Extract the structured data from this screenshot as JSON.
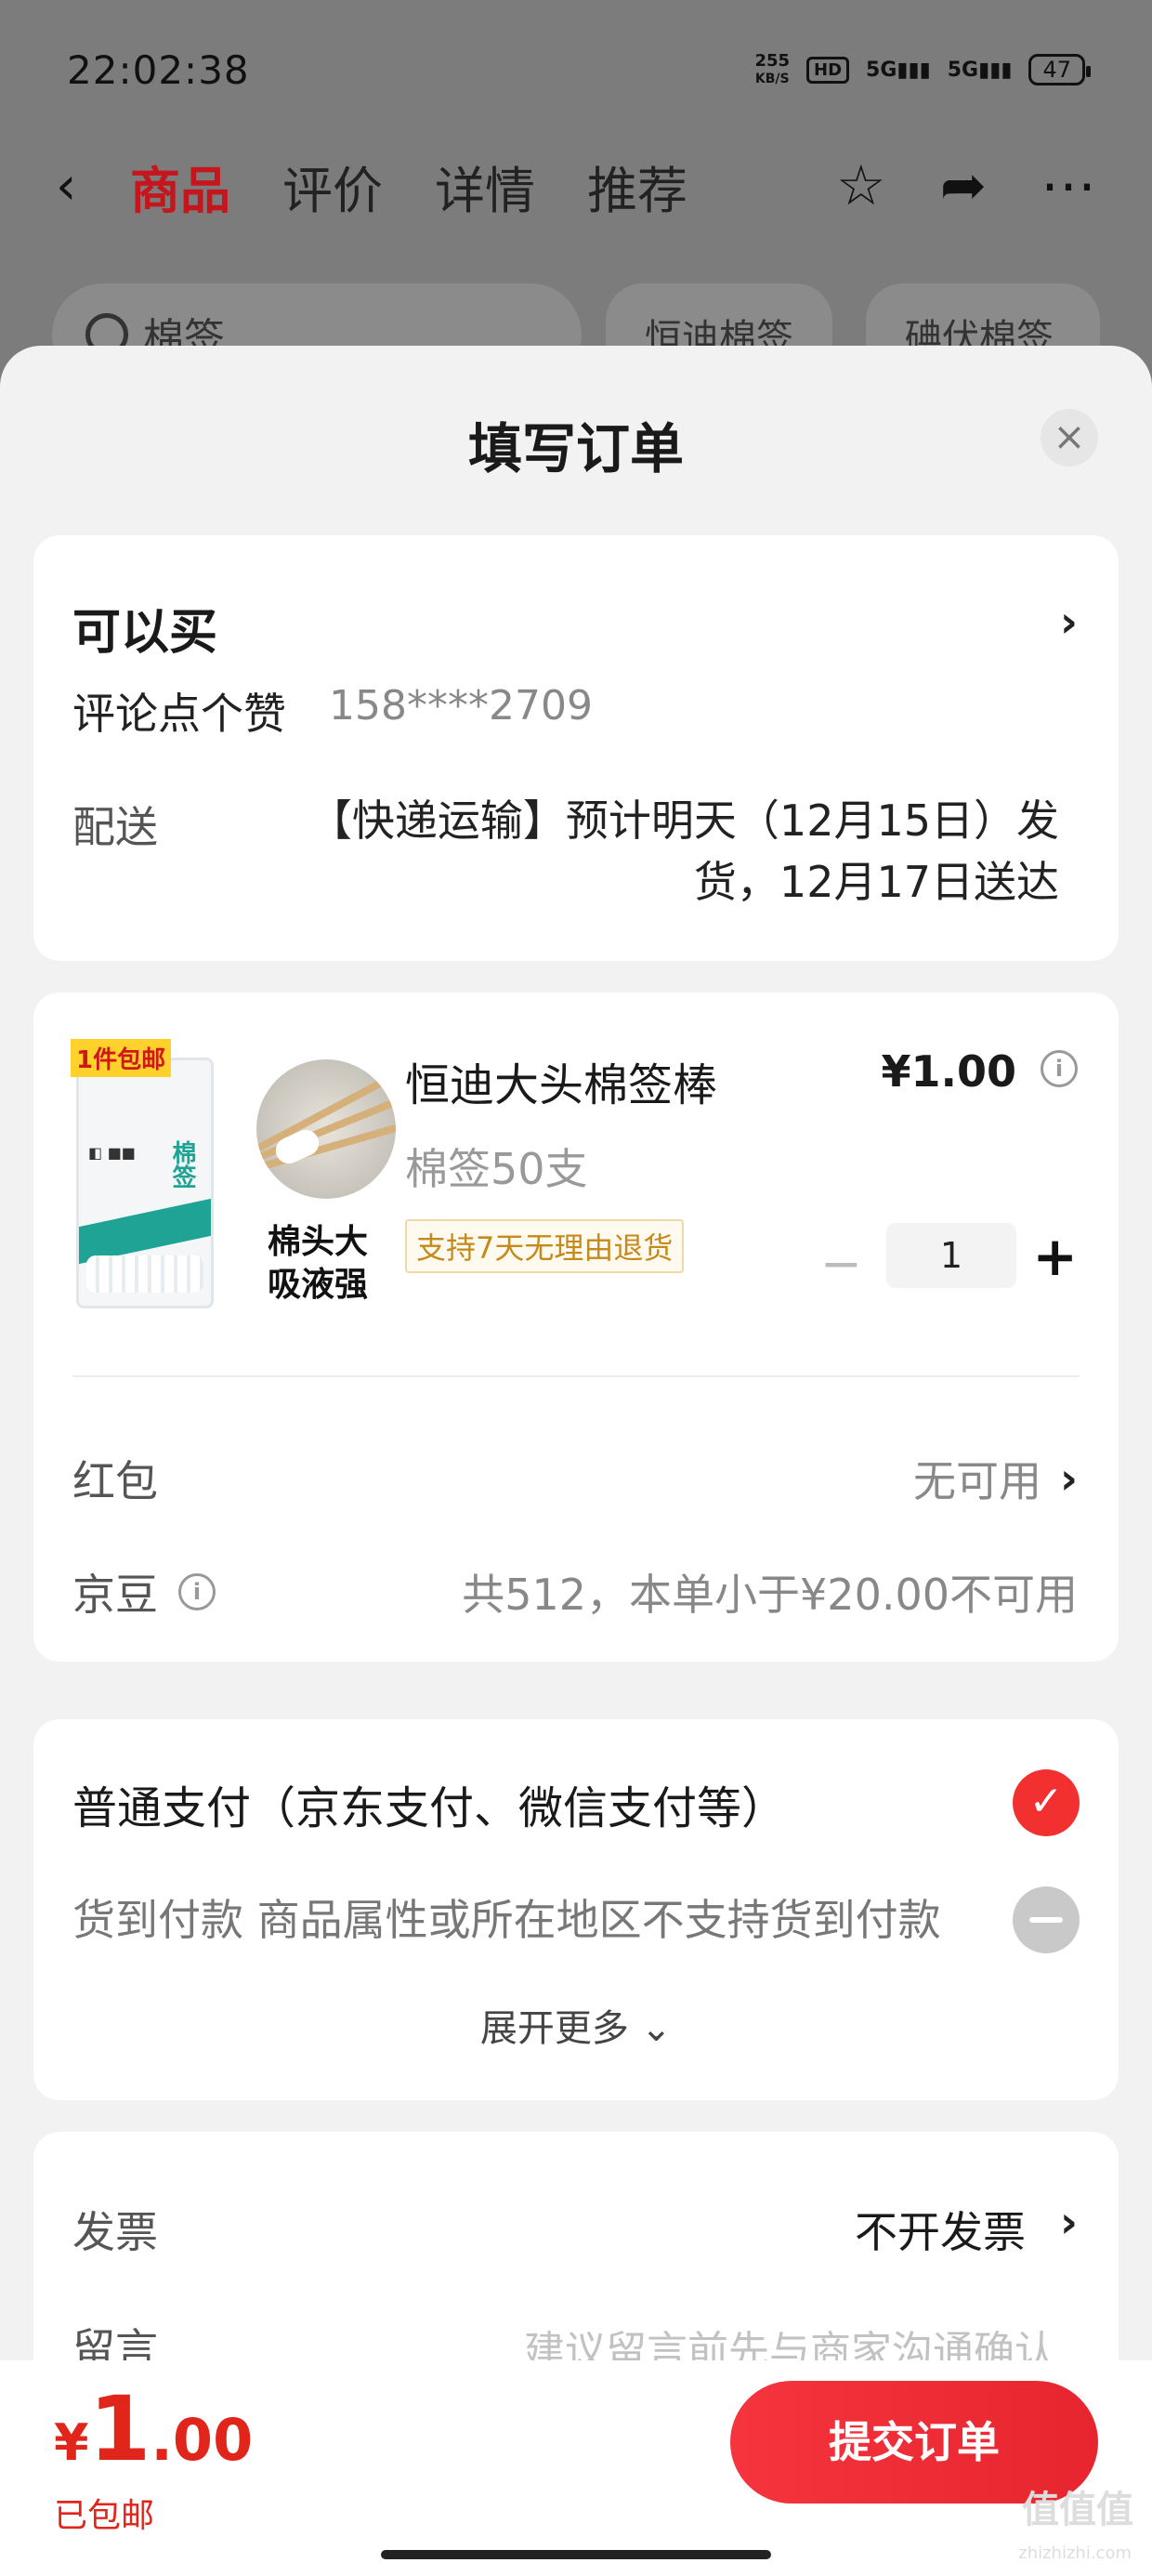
{
  "status_bar": {
    "time": "22:02:38",
    "speed": "255",
    "speed_unit": "KB/S",
    "hd": "HD",
    "signal1": "5G",
    "signal2": "5G",
    "battery": "47"
  },
  "nav": {
    "tabs": [
      "商品",
      "评价",
      "详情",
      "推荐"
    ],
    "active_tab": "商品"
  },
  "background": {
    "search_text": "棉签",
    "chips": [
      "恒迪棉签",
      "碘伏棉签"
    ]
  },
  "sheet": {
    "title": "填写订单",
    "close": "×"
  },
  "address": {
    "name": "可以买",
    "user": "评论点个赞",
    "phone": "158****2709",
    "delivery_label": "配送",
    "delivery_text": "【快递运输】预计明天（12月15日）发货，12月17日送达"
  },
  "product": {
    "badge": "1件包邮",
    "image_text_line1": "棉头大",
    "image_text_line2": "吸液强",
    "package_brand": "棉签",
    "title": "恒迪大头棉签棒",
    "spec": "棉签50支",
    "return_policy": "支持7天无理由退货",
    "price": "¥1.00",
    "quantity": "1",
    "minus": "−",
    "plus": "+"
  },
  "discounts": {
    "redpacket_label": "红包",
    "redpacket_value": "无可用",
    "jingdou_label": "京豆",
    "jingdou_value": "共512，本单小于¥20.00不可用"
  },
  "payment": {
    "option1": "普通支付（京东支付、微信支付等）",
    "option2": "货到付款 商品属性或所在地区不支持货到付款",
    "more": "展开更多 ⌄"
  },
  "invoice": {
    "label": "发票",
    "value": "不开发票",
    "note_label": "留言",
    "note_placeholder": "建议留言前先与商家沟通确认"
  },
  "footer": {
    "currency": "¥",
    "total_int": "1",
    "total_dec": ".00",
    "shipping": "已包邮",
    "submit": "提交订单",
    "watermark": "值值值",
    "watermark_url": "zhizhizhi.com"
  },
  "colors": {
    "accent": "#e1251b",
    "active_tab": "#c5161d",
    "check": "#f23030"
  }
}
